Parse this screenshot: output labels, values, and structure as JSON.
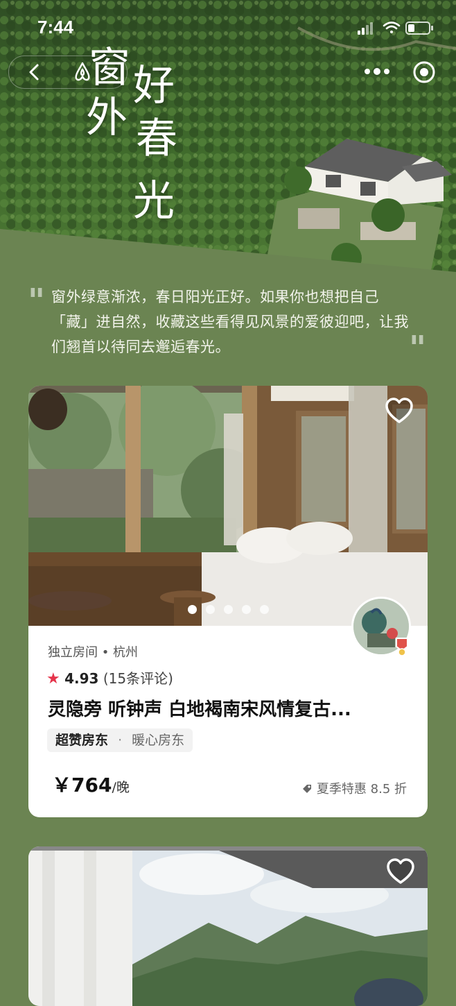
{
  "status_bar": {
    "time": "7:44"
  },
  "header": {
    "title_chars": [
      "窗",
      "好",
      "外",
      "春",
      "光"
    ],
    "back_icon": "chevron-left-icon",
    "logo_icon": "airbnb-logo-icon",
    "more_icon": "more-dots-icon",
    "capsule_icon": "target-circle-icon"
  },
  "intro": {
    "text": "窗外绿意渐浓，春日阳光正好。如果你也想把自己「藏」进自然，收藏这些看得见风景的爱彼迎吧，让我们翘首以待同去邂逅春光。"
  },
  "listings": [
    {
      "meta": "独立房间 • 杭州",
      "star": "★",
      "rating": "4.93",
      "reviews": "(15条评论)",
      "title": "灵隐旁 听钟声 白地褐南宋风情复古...",
      "tag_main": "超赞房东",
      "tag_sep": "·",
      "tag_sub": "暖心房东",
      "currency": "￥",
      "price": "764",
      "price_unit": "/晚",
      "promo": "夏季特惠 8.5 折",
      "photo_count": 5,
      "active_photo": 1
    }
  ],
  "colors": {
    "background": "#6b8452",
    "star": "#e5344b"
  }
}
